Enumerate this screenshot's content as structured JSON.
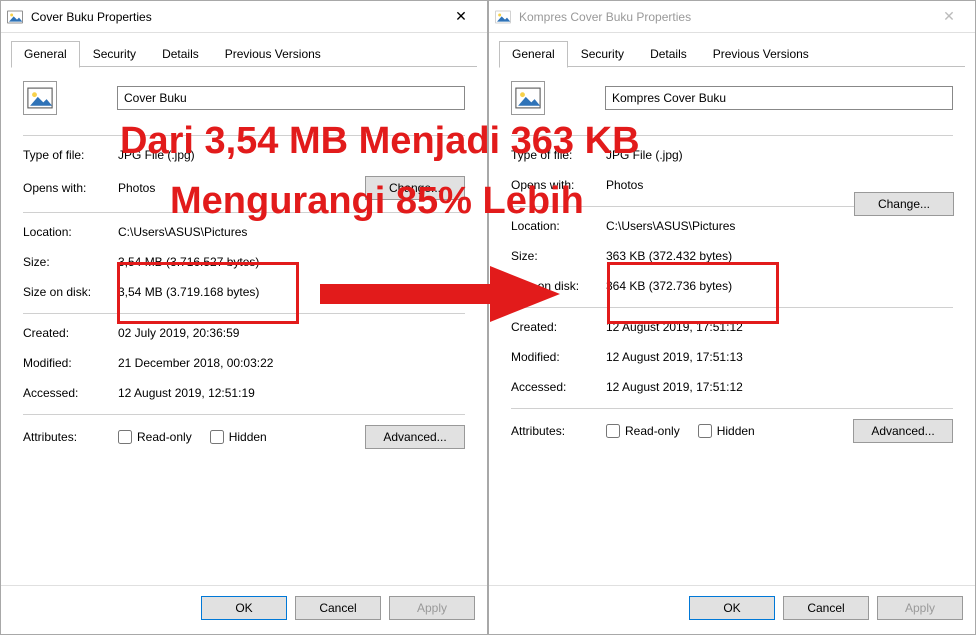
{
  "left_dialog": {
    "title": "Cover Buku Properties",
    "tabs": {
      "general": "General",
      "security": "Security",
      "details": "Details",
      "prev": "Previous Versions"
    },
    "filename": "Cover Buku",
    "type_label": "Type of file:",
    "type_value": "JPG File (.jpg)",
    "opens_label": "Opens with:",
    "opens_value": "Photos",
    "change_label": "Change...",
    "location_label": "Location:",
    "location_value": "C:\\Users\\ASUS\\Pictures",
    "size_label": "Size:",
    "size_value": "3,54 MB (3.716.527 bytes)",
    "sizeondisk_label": "Size on disk:",
    "sizeondisk_value": "3,54 MB (3.719.168 bytes)",
    "created_label": "Created:",
    "created_value": "02 July 2019, 20:36:59",
    "modified_label": "Modified:",
    "modified_value": "21 December 2018, 00:03:22",
    "accessed_label": "Accessed:",
    "accessed_value": "12 August 2019, 12:51:19",
    "attr_label": "Attributes:",
    "readonly_label": "Read-only",
    "hidden_label": "Hidden",
    "advanced_label": "Advanced...",
    "ok": "OK",
    "cancel": "Cancel",
    "apply": "Apply"
  },
  "right_dialog": {
    "title": "Kompres Cover Buku Properties",
    "tabs": {
      "general": "General",
      "security": "Security",
      "details": "Details",
      "prev": "Previous Versions"
    },
    "filename": "Kompres Cover Buku",
    "type_label": "Type of file:",
    "type_value": "JPG File (.jpg)",
    "opens_label": "Opens with:",
    "opens_value": "Photos",
    "change_label": "Change...",
    "location_label": "Location:",
    "location_value": "C:\\Users\\ASUS\\Pictures",
    "size_label": "Size:",
    "size_value": "363 KB (372.432 bytes)",
    "sizeondisk_label": "Size on disk:",
    "sizeondisk_value": "364 KB (372.736 bytes)",
    "created_label": "Created:",
    "created_value": "12 August 2019, 17:51:12",
    "modified_label": "Modified:",
    "modified_value": "12 August 2019, 17:51:13",
    "accessed_label": "Accessed:",
    "accessed_value": "12 August 2019, 17:51:12",
    "attr_label": "Attributes:",
    "readonly_label": "Read-only",
    "hidden_label": "Hidden",
    "advanced_label": "Advanced...",
    "ok": "OK",
    "cancel": "Cancel",
    "apply": "Apply"
  },
  "annotation": {
    "line1": "Dari 3,54 MB Menjadi 363 KB",
    "line2": "Mengurangi 85% Lebih"
  }
}
